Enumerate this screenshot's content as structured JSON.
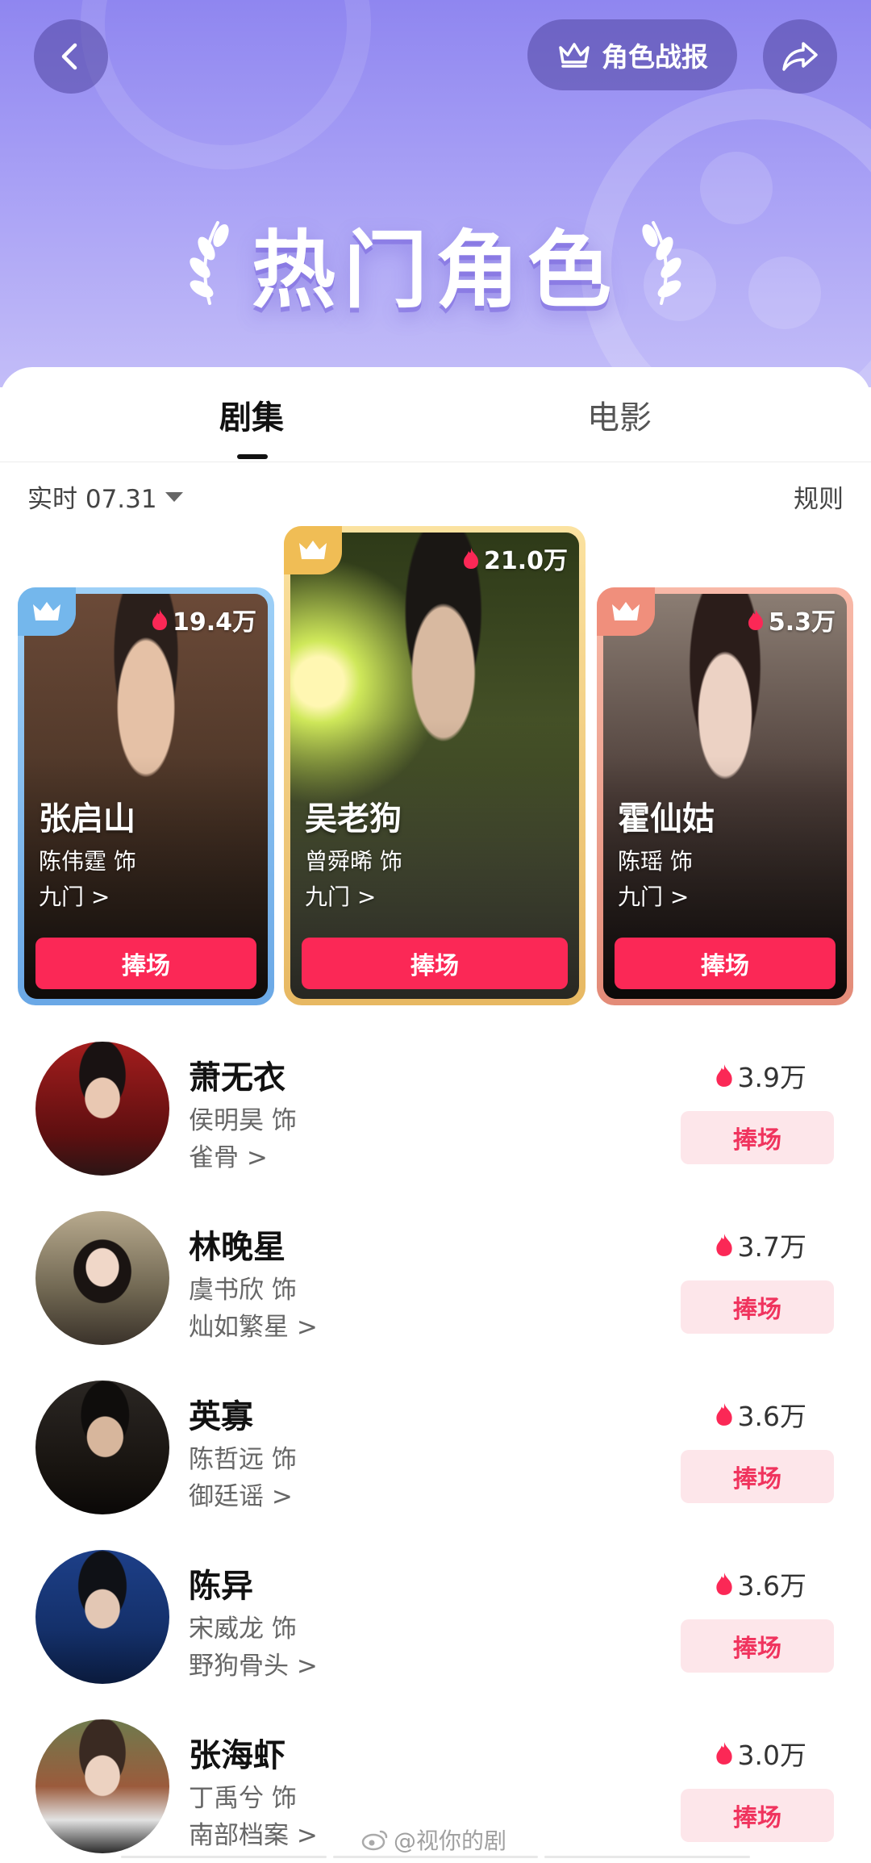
{
  "header": {
    "back_icon": "back-arrow-icon",
    "report_label": "角色战报",
    "report_icon": "crown-outline-icon",
    "share_icon": "share-arrow-icon",
    "title": "热门角色"
  },
  "tabs": [
    {
      "label": "剧集",
      "active": true
    },
    {
      "label": "电影",
      "active": false
    }
  ],
  "filter": {
    "label": "实时 07.31",
    "icon": "caret-down-icon"
  },
  "rules_label": "规则",
  "colors": {
    "accent": "#fb2856",
    "accent_light": "#fde6ea",
    "hero_purple": "#8f86f0"
  },
  "top3": [
    {
      "rank": 2,
      "name": "张启山",
      "actor": "陈伟霆 饰",
      "show": "九门 >",
      "heat": "19.4万",
      "button": "捧场",
      "crown_color": "#74b7ec"
    },
    {
      "rank": 1,
      "name": "吴老狗",
      "actor": "曾舜晞 饰",
      "show": "九门 >",
      "heat": "21.0万",
      "button": "捧场",
      "crown_color": "#f0bd55"
    },
    {
      "rank": 3,
      "name": "霍仙姑",
      "actor": "陈瑶 饰",
      "show": "九门 >",
      "heat": "5.3万",
      "button": "捧场",
      "crown_color": "#f08f7c"
    }
  ],
  "list": [
    {
      "name": "萧无衣",
      "actor": "侯明昊 饰",
      "show": "雀骨 >",
      "heat": "3.9万",
      "button": "捧场"
    },
    {
      "name": "林晚星",
      "actor": "虞书欣 饰",
      "show": "灿如繁星 >",
      "heat": "3.7万",
      "button": "捧场"
    },
    {
      "name": "英寡",
      "actor": "陈哲远 饰",
      "show": "御廷谣 >",
      "heat": "3.6万",
      "button": "捧场"
    },
    {
      "name": "陈异",
      "actor": "宋威龙 饰",
      "show": "野狗骨头 >",
      "heat": "3.6万",
      "button": "捧场"
    },
    {
      "name": "张海虾",
      "actor": "丁禹兮 饰",
      "show": "南部档案 >",
      "heat": "3.0万",
      "button": "捧场"
    }
  ],
  "watermark": "@视你的剧"
}
